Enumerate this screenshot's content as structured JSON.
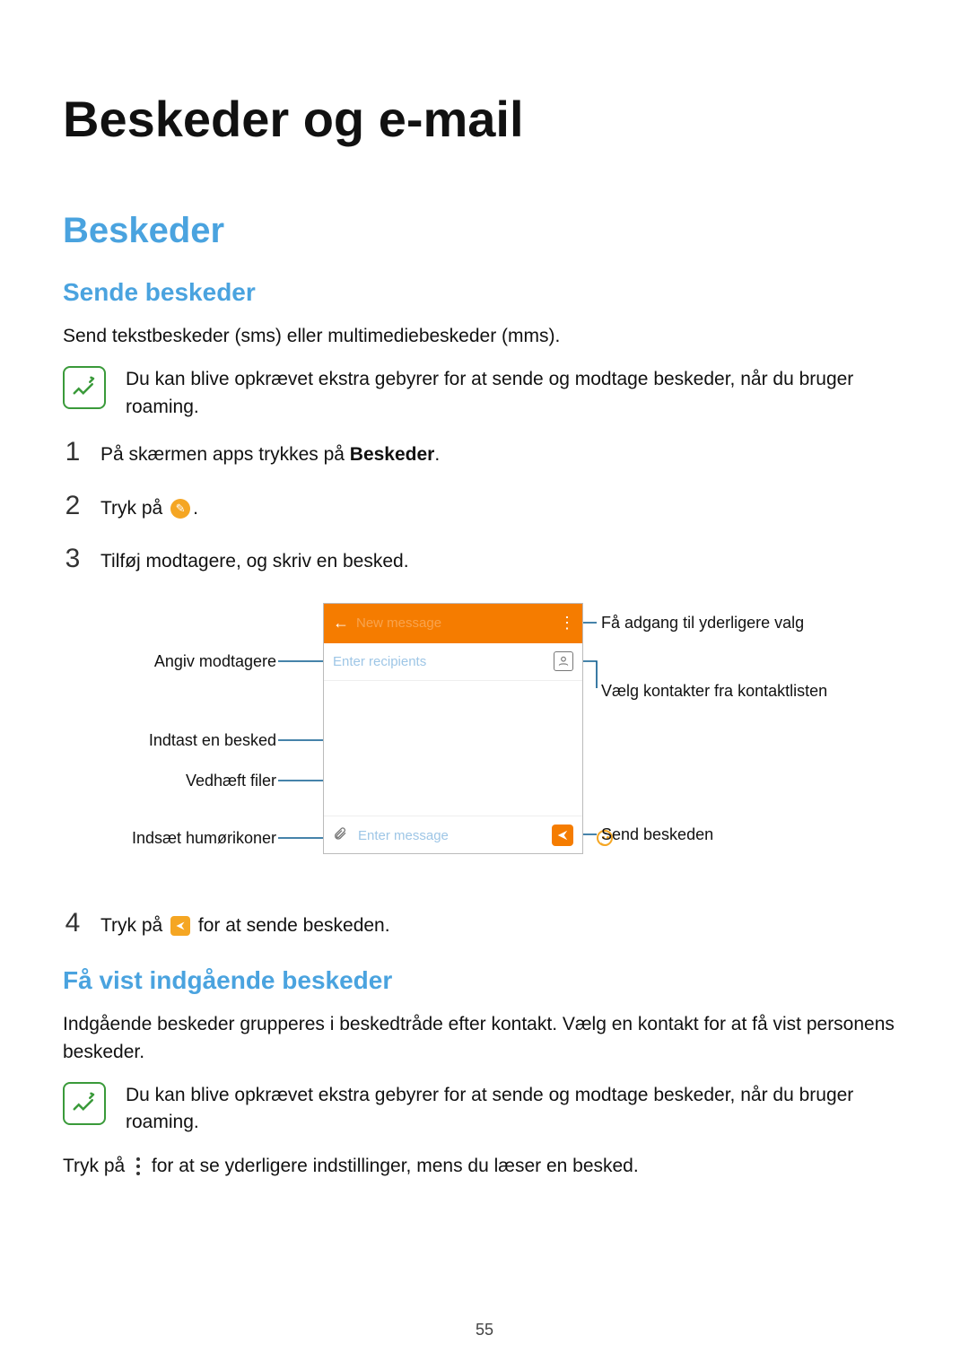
{
  "page_number": "55",
  "h1": "Beskeder og e-mail",
  "section1": {
    "h2": "Beskeder",
    "h3": "Sende beskeder",
    "intro": "Send tekstbeskeder (sms) eller multimediebeskeder (mms).",
    "note": "Du kan blive opkrævet ekstra gebyrer for at sende og modtage beskeder, når du bruger roaming."
  },
  "steps": {
    "s1": {
      "num": "1",
      "pre": "På skærmen apps trykkes på ",
      "bold": "Beskeder",
      "post": "."
    },
    "s2": {
      "num": "2",
      "pre": "Tryk på ",
      "post": "."
    },
    "s3": {
      "num": "3",
      "text": "Tilføj modtagere, og skriv en besked."
    },
    "s4": {
      "num": "4",
      "pre": "Tryk på ",
      "post": " for at sende beskeden."
    }
  },
  "diagram": {
    "callouts": {
      "topright": "Få adgang til yderligere valg",
      "recipients_left": "Angiv modtagere",
      "contacts_right": "Vælg kontakter fra kontaktlisten",
      "enter_msg_left": "Indtast en besked",
      "attach_left": "Vedhæft filer",
      "emoji_left": "Indsæt humørikoner",
      "send_right": "Send beskeden"
    },
    "phone": {
      "header_title_placeholder": "New message",
      "recipient_placeholder": "Enter recipients",
      "message_placeholder": "Enter message"
    }
  },
  "section2": {
    "h3": "Få vist indgående beskeder",
    "body": "Indgående beskeder grupperes i beskedtråde efter kontakt. Vælg en kontakt for at få vist personens beskeder.",
    "note": "Du kan blive opkrævet ekstra gebyrer for at sende og modtage beskeder, når du bruger roaming.",
    "tail_pre": "Tryk på ",
    "tail_post": " for at se yderligere indstillinger, mens du læser en besked."
  }
}
